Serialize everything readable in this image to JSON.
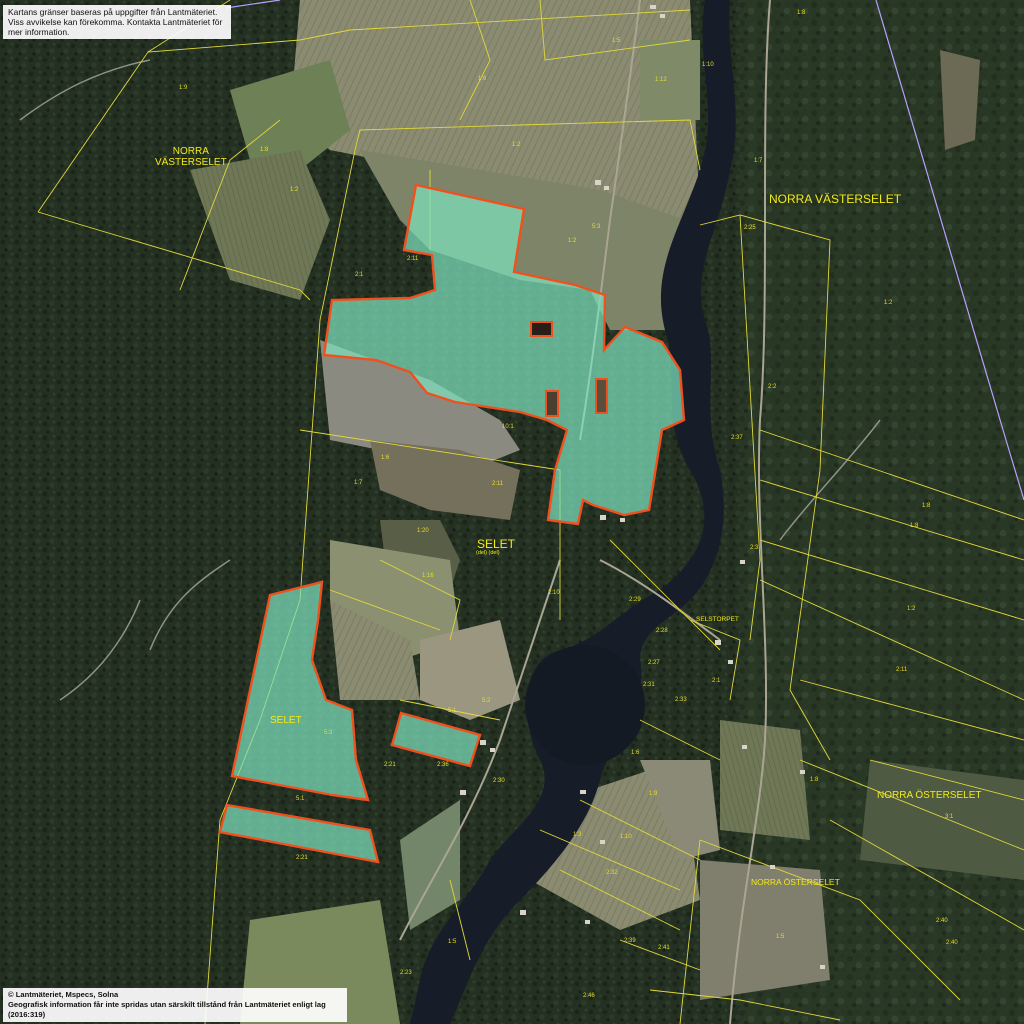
{
  "notice_top": {
    "line1": "Kartans gränser baseras på uppgifter från Lantmäteriet.",
    "line2": "Viss avvikelse kan förekomma. Kontakta Lantmäteriet för mer information."
  },
  "notice_bottom": {
    "line1": "© Lantmäteriet, Mspecs, Solna",
    "line2": "Geografisk information får inte spridas utan särskilt tillstånd från Lantmäteriet enligt lag (2016:319)"
  },
  "place_names": {
    "norra_vasterselet_left_1": "NORRA",
    "norra_vasterselet_left_2": "VÄSTERSELET",
    "norra_vasterselet_right": "NORRA VÄSTERSELET",
    "selet_center": "SELET",
    "selet_center_sub": "(del)   (del)",
    "selet_lower": "SELET",
    "selstorpet": "SELSTORPET",
    "norra_osterselet_right": "NORRA ÖSTERSELET",
    "norra_osterselet_lower": "NORRA ÖSTERSELET"
  },
  "lot_labels": [
    "1:8",
    "1:5",
    "1:10",
    "1:6",
    "1:12",
    "1:9",
    "1:2",
    "1:8",
    "1:7",
    "1:2",
    "2:11",
    "2:1",
    "5:3",
    "2:25",
    "1:2",
    "2:2",
    "2:37",
    "1:8",
    "1:8",
    "1:2",
    "2:11",
    "2:11",
    "1:20",
    "1:16",
    "2:29",
    "2:28",
    "2:27",
    "2:31",
    "2:33",
    "1:6",
    "1:10",
    "1:9",
    "2:32",
    "2:39",
    "2:41",
    "2:40",
    "1:5",
    "2:46",
    "2:23",
    "2:30",
    "2:36",
    "2:21",
    "2:21",
    "5:1",
    "5:3",
    "1:5",
    "2:40",
    "3:1",
    "1:8",
    "1:3",
    "5:1",
    "5:2",
    "1:2",
    "2:3",
    "2:1",
    "2:10",
    "1:7",
    "10:1",
    "1:6"
  ],
  "colors": {
    "property_fill": "#7ee0bc",
    "property_border": "#f0501e",
    "boundary_line": "#e0d83a",
    "municipal_line": "#b8a0ff",
    "place_text": "#f3ea1a",
    "river": "#161d28"
  }
}
